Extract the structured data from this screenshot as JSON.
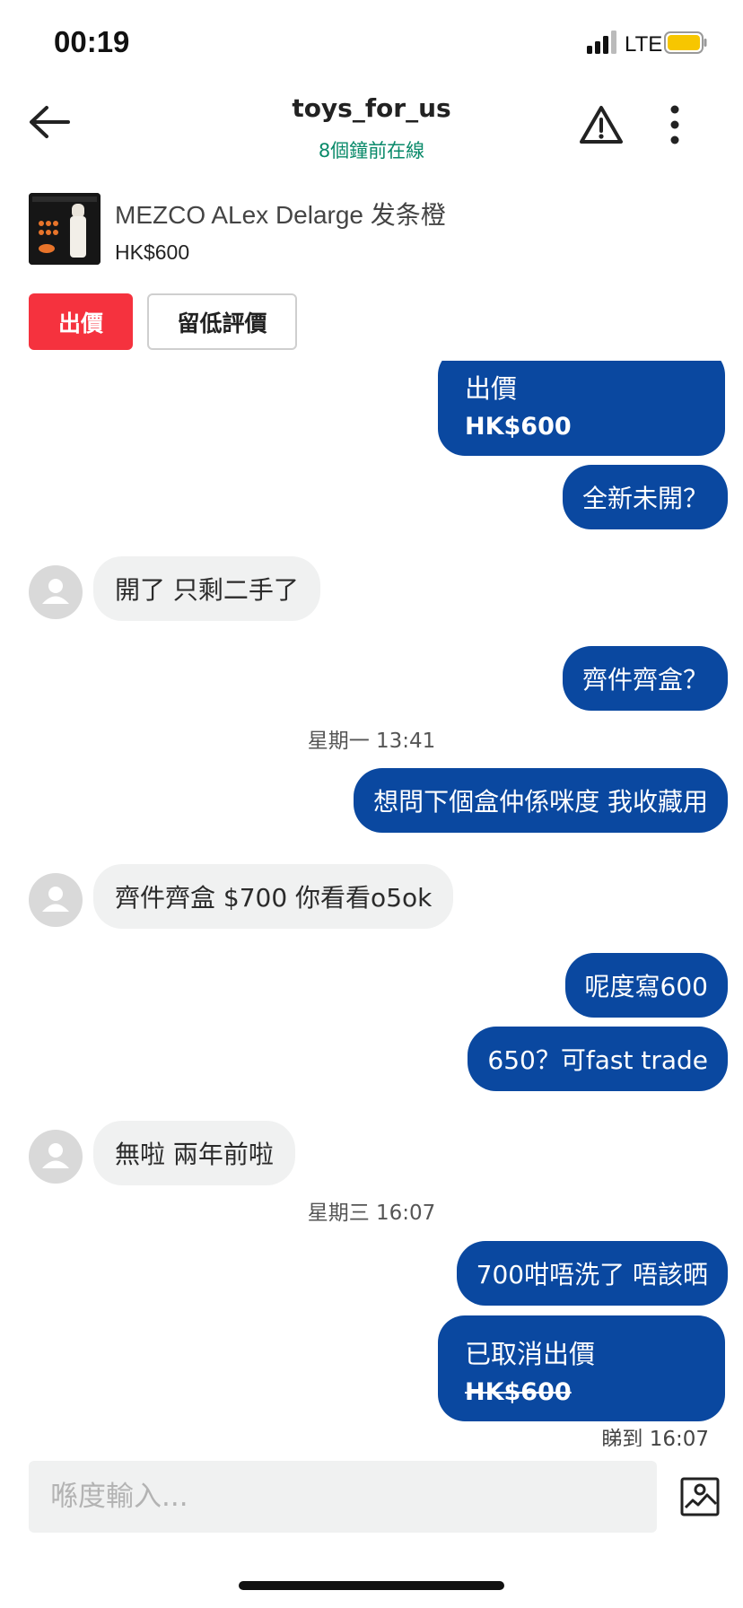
{
  "status_bar": {
    "time": "00:19",
    "network": "LTE",
    "battery_color": "#f7c600"
  },
  "header": {
    "title": "toys_for_us",
    "subtitle": "8個鐘前在線"
  },
  "product": {
    "name": "MEZCO ALex Delarge 发条橙",
    "price": "HK$600"
  },
  "actions": {
    "offer_label": "出價",
    "review_label": "留低評價"
  },
  "messages": {
    "offer_top": {
      "label": "出價",
      "amount": "HK$600"
    },
    "m1": "全新未開？",
    "m2": "開了 只剩二手了",
    "m3": "齊件齊盒？",
    "ts1": "星期一 13:41",
    "m4": "想問下個盒仲係咪度 我收藏用",
    "m5": "齊件齊盒 $700 你看看o5ok",
    "m6": "呢度寫600",
    "m7": "650？可fast trade",
    "m8": "無啦 兩年前啦",
    "ts2": "星期三 16:07",
    "m9": "700咁唔洗了 唔該晒",
    "offer_cancel": {
      "label": "已取消出價",
      "amount": "HK$600"
    },
    "read_receipt": "睇到 16:07"
  },
  "composer": {
    "placeholder": "喺度輸入..."
  },
  "colors": {
    "outgoing": "#0a48a0",
    "incoming": "#f0f1f1",
    "offer_button": "#f5323e",
    "online": "#0a8a6a"
  }
}
